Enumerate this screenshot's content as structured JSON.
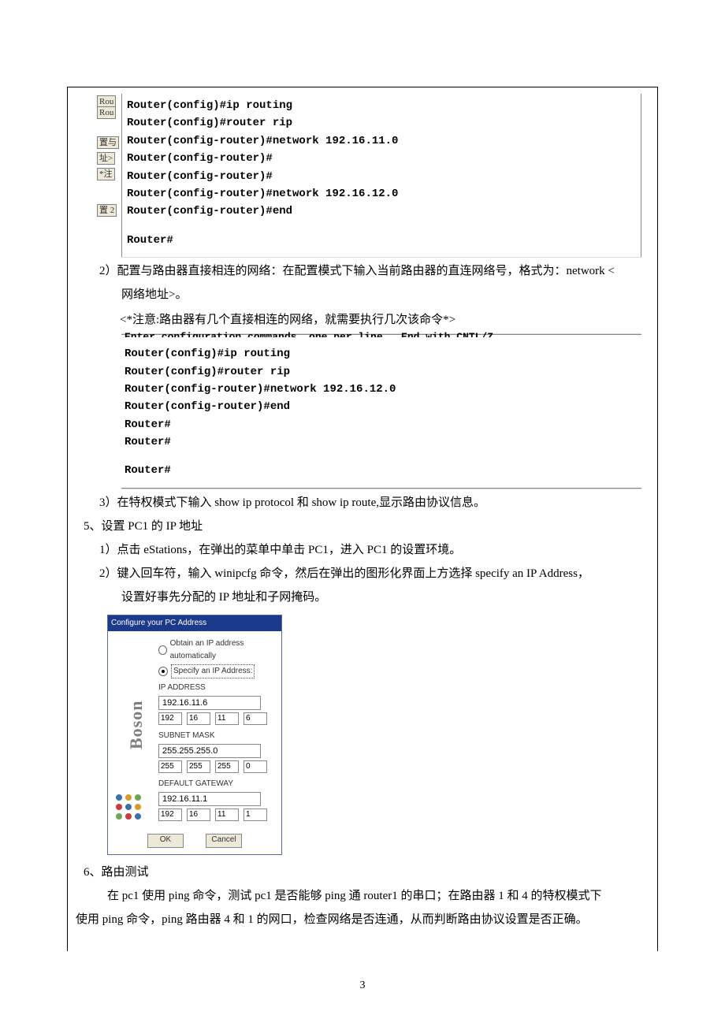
{
  "terminal1": {
    "frags": {
      "rou1": "Rou",
      "rou2": "Rou",
      "a": "置与",
      "b": "址>",
      "c": "*注",
      "d": "置 2"
    },
    "lines": [
      "Router(config)#ip routing",
      "Router(config)#router rip",
      "Router(config-router)#network 192.16.11.0",
      "Router(config-router)#",
      "Router(config-router)#",
      "Router(config-router)#network 192.16.12.0",
      "Router(config-router)#end",
      "",
      "Router#"
    ]
  },
  "step2": {
    "line1": "2）配置与路由器直接相连的网络：在配置模式下输入当前路由器的直连网络号，格式为：network <",
    "line2": "网络地址>。"
  },
  "note": "<*注意:路由器有几个直接相连的网络，就需要执行几次该命令*>",
  "terminal2": {
    "top_trunc": "Enter configuration commands, one per line.  End with CNTL/Z.",
    "lines": [
      "Router(config)#ip routing",
      "Router(config)#router rip",
      "Router(config-router)#network 192.16.12.0",
      "Router(config-router)#end",
      "Router#",
      "Router#",
      "",
      "Router#"
    ]
  },
  "step3": "3）在特权模式下输入 show ip protocol 和 show ip route,显示路由协议信息。",
  "sec5": {
    "title": "5、设置 PC1 的 IP 地址",
    "s1": "1）点击 eStations，在弹出的菜单中单击 PC1，进入 PC1 的设置环境。",
    "s2a": "2）键入回车符，输入 winipcfg 命令，然后在弹出的图形化界面上方选择 specify an IP Address，",
    "s2b": "设置好事先分配的 IP 地址和子网掩码。"
  },
  "dialog": {
    "title": "Configure your PC Address",
    "boson": "Boson",
    "auto_label": "Obtain an IP address automatically",
    "spec_label": "Specify an IP Address:",
    "ip_label": "IP ADDRESS",
    "ip_full": "192.16.11.6",
    "ip_oct": [
      "192",
      "16",
      "11",
      "6"
    ],
    "mask_label": "SUBNET MASK",
    "mask_full": "255.255.255.0",
    "mask_oct": [
      "255",
      "255",
      "255",
      "0"
    ],
    "gw_label": "DEFAULT GATEWAY",
    "gw_full": "192.16.11.1",
    "gw_oct": [
      "192",
      "16",
      "11",
      "1"
    ],
    "ok": "OK",
    "cancel": "Cancel"
  },
  "sec6": {
    "title": "6、路由测试",
    "p1": "    在 pc1 使用 ping 命令，测试 pc1 是否能够 ping 通 router1 的串口；在路由器 1 和 4 的特权模式下",
    "p2": "使用 ping 命令，ping 路由器 4 和 1 的网口，检查网络是否连通，从而判断路由协议设置是否正确。"
  },
  "page_number": "3"
}
